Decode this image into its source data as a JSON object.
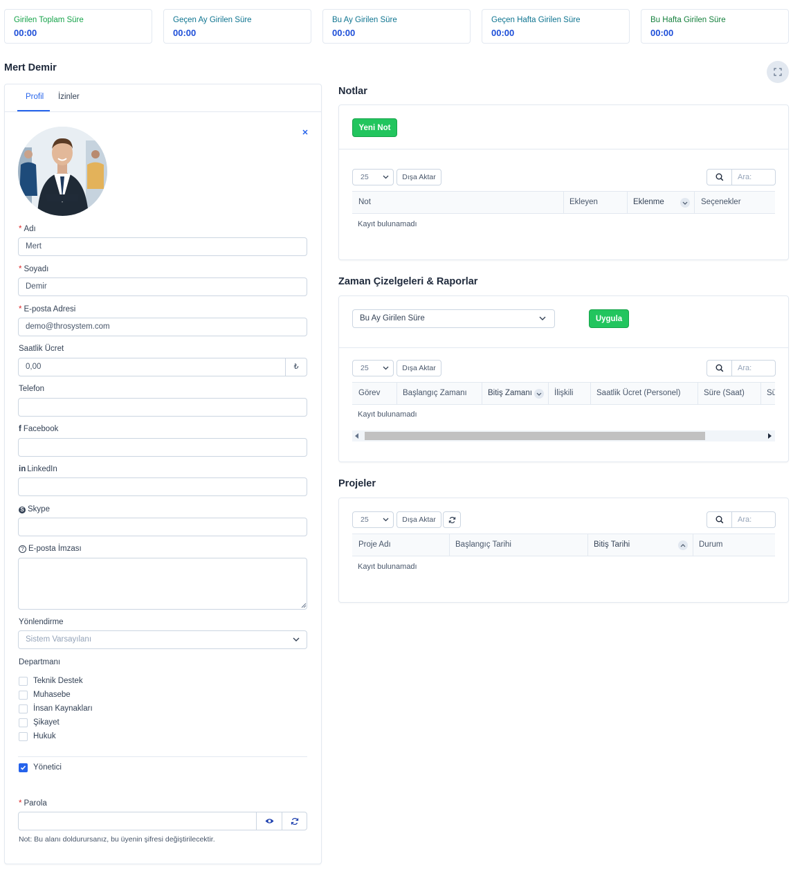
{
  "stats": [
    {
      "label": "Girilen Toplam Süre",
      "value": "00:00",
      "color": "#16a34a"
    },
    {
      "label": "Geçen Ay Girilen Süre",
      "value": "00:00",
      "color": "#0e7490"
    },
    {
      "label": "Bu Ay Girilen Süre",
      "value": "00:00",
      "color": "#0e7490"
    },
    {
      "label": "Geçen Hafta Girilen Süre",
      "value": "00:00",
      "color": "#0e7490"
    },
    {
      "label": "Bu Hafta Girilen Süre",
      "value": "00:00",
      "color": "#15803d"
    }
  ],
  "page_title": "Mert Demir",
  "profile": {
    "tabs": [
      "Profil",
      "İzinler"
    ],
    "first_name": {
      "label": "Adı",
      "value": "Mert"
    },
    "last_name": {
      "label": "Soyadı",
      "value": "Demir"
    },
    "email": {
      "label": "E-posta Adresi",
      "value": "demo@throsystem.com"
    },
    "hourly_rate": {
      "label": "Saatlik Ücret",
      "value": "0,00",
      "currency": "₺"
    },
    "phone": {
      "label": "Telefon",
      "value": ""
    },
    "facebook": {
      "label": "Facebook",
      "value": ""
    },
    "linkedin": {
      "label": "LinkedIn",
      "value": ""
    },
    "skype": {
      "label": "Skype",
      "value": ""
    },
    "signature": {
      "label": "E-posta İmzası",
      "value": ""
    },
    "direction": {
      "label": "Yönlendirme",
      "value": "Sistem Varsayılanı"
    },
    "departments_label": "Departmanı",
    "departments": [
      "Teknik Destek",
      "Muhasebe",
      "İnsan Kaynakları",
      "Şikayet",
      "Hukuk"
    ],
    "admin_label": "Yönetici",
    "password": {
      "label": "Parola",
      "value": ""
    },
    "password_note": "Not: Bu alanı doldurursanız, bu üyenin şifresi değiştirilecektir."
  },
  "notes": {
    "title": "Notlar",
    "new_button": "Yeni Not",
    "page_size": "25",
    "export_button": "Dışa Aktar",
    "search_placeholder": "Ara:",
    "columns": [
      "Not",
      "Ekleyen",
      "Eklenme",
      "Seçenekler"
    ],
    "empty": "Kayıt bulunamadı"
  },
  "timesheets": {
    "title": "Zaman Çizelgeleri & Raporlar",
    "filter_value": "Bu Ay Girilen Süre",
    "apply_button": "Uygula",
    "page_size": "25",
    "export_button": "Dışa Aktar",
    "search_placeholder": "Ara:",
    "columns": [
      "Görev",
      "Başlangıç Zamanı",
      "Bitiş Zamanı",
      "İlişkili",
      "Saatlik Ücret (Personel)",
      "Süre (Saat)",
      "Sü"
    ],
    "empty": "Kayıt bulunamadı"
  },
  "projects": {
    "title": "Projeler",
    "page_size": "25",
    "export_button": "Dışa Aktar",
    "search_placeholder": "Ara:",
    "columns": [
      "Proje Adı",
      "Başlangıç Tarihi",
      "Bitiş Tarihi",
      "Durum"
    ],
    "empty": "Kayıt bulunamadı"
  },
  "colors": {
    "accent": "#2563eb",
    "green": "#22c55e",
    "value_blue": "#1d4ed8"
  }
}
